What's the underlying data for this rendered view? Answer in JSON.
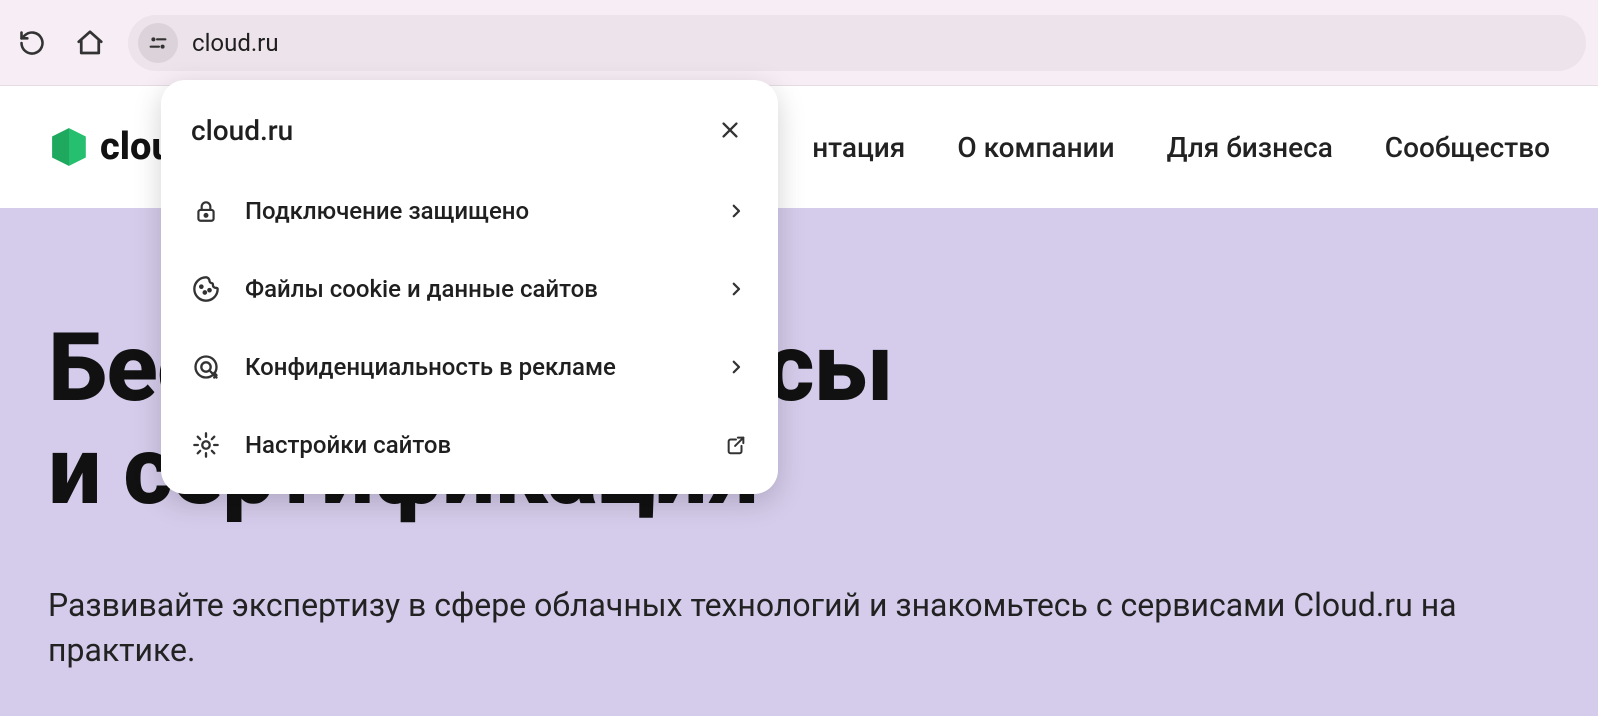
{
  "browser": {
    "url": "cloud.ru"
  },
  "site": {
    "logo_text": "cloud",
    "nav": {
      "doc_tail": "нтация",
      "about": "О компании",
      "business": "Для бизнеса",
      "community": "Сообщество"
    }
  },
  "hero": {
    "title_line1": "Бесплатные курсы",
    "title_line2": "и сертификация",
    "sub": "Развивайте экспертизу в сфере облачных технологий и знакомьтесь с сервисами Cloud.ru на практике."
  },
  "popup": {
    "title": "cloud.ru",
    "items": [
      {
        "label": "Подключение защищено"
      },
      {
        "label": "Файлы cookie и данные сайтов"
      },
      {
        "label": "Конфиденциальность в рекламе"
      },
      {
        "label": "Настройки сайтов"
      }
    ]
  }
}
